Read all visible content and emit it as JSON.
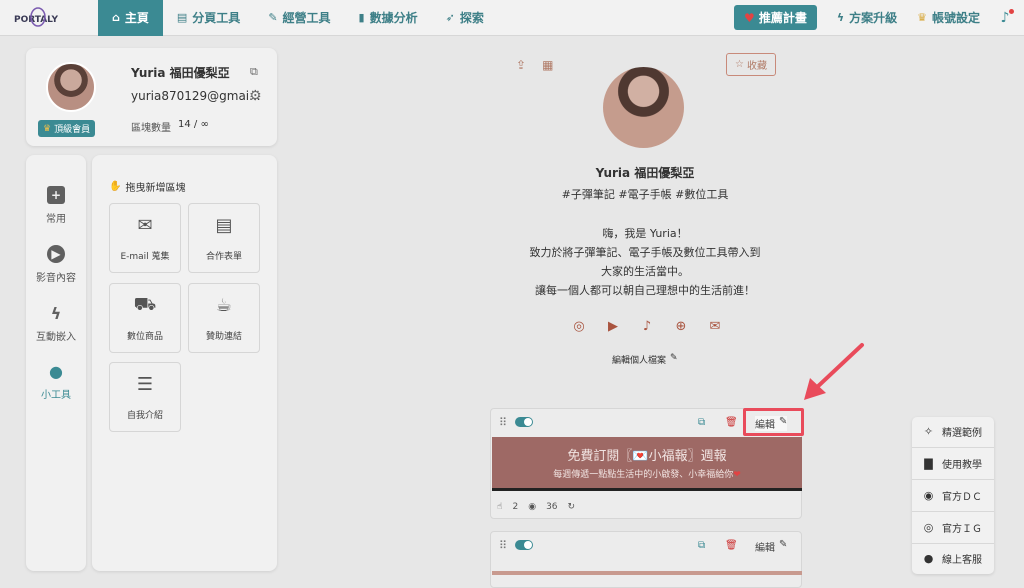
{
  "nav": {
    "items": [
      {
        "label": "主頁",
        "icon": "home-icon",
        "active": true
      },
      {
        "label": "分頁工具",
        "icon": "pages-icon"
      },
      {
        "label": "經營工具",
        "icon": "wrench-icon"
      },
      {
        "label": "數據分析",
        "icon": "chart-icon"
      },
      {
        "label": "探索",
        "icon": "rocket-icon"
      }
    ],
    "recommend_label": "推薦計畫",
    "upgrade_label": "方案升級",
    "account_label": "帳號設定"
  },
  "profile": {
    "name": "Yuria 福田優梨亞",
    "email": "yuria870129@gmai...",
    "member_badge": "頂級會員",
    "block_count_label": "區塊數量",
    "block_count_value": "14 / ∞"
  },
  "side_tabs": [
    {
      "label": "常用"
    },
    {
      "label": "影音內容"
    },
    {
      "label": "互動嵌入"
    },
    {
      "label": "小工具",
      "active": true
    }
  ],
  "blocks_panel": {
    "heading": "拖曳新增區塊",
    "tiles": [
      {
        "label": "E-mail 蒐集"
      },
      {
        "label": "合作表單"
      },
      {
        "label": "數位商品"
      },
      {
        "label": "贊助連結"
      },
      {
        "label": "自我介紹"
      }
    ]
  },
  "preview": {
    "favorite_label": "收藏",
    "name": "Yuria 福田優梨亞",
    "tags": "#子彈筆記 #電子手帳 #數位工具",
    "bio": [
      "嗨，我是 Yuria！",
      "致力於將子彈筆記、電子手帳及數位工具帶入到",
      "大家的生活當中。",
      "讓每一個人都可以朝自己理想中的生活前進！"
    ],
    "edit_profile_label": "編輯個人檔案"
  },
  "block1": {
    "edit_label": "編輯",
    "banner_title": "免費訂閱〖💌小福報〗週報",
    "banner_subtitle": "每週傳遞一點點生活中的小啟發、小幸福給你",
    "clicks": "2",
    "views": "36"
  },
  "block2": {
    "edit_label": "編輯"
  },
  "float_menu": [
    {
      "label": "精選範例",
      "icon": "bulb-icon"
    },
    {
      "label": "使用教學",
      "icon": "book-icon"
    },
    {
      "label": "官方ＤＣ",
      "icon": "discord-icon"
    },
    {
      "label": "官方ＩＧ",
      "icon": "instagram-icon"
    },
    {
      "label": "線上客服",
      "icon": "line-icon"
    }
  ],
  "colors": {
    "accent": "#3b8a93",
    "highlight": "#e94b5b",
    "banner": "#9e6965"
  }
}
